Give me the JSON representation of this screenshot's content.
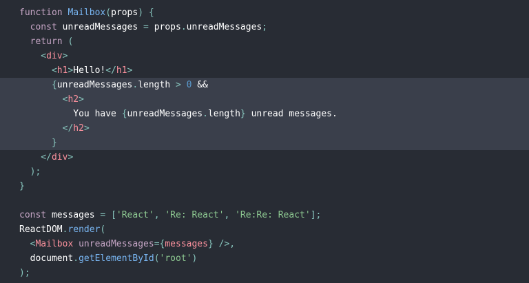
{
  "editor": {
    "colors": {
      "background": "#282c34",
      "highlight": "#3a3f4b",
      "keyword": "#c5a5c5",
      "function": "#79b6f2",
      "tag": "#fc929e",
      "string": "#8dc891",
      "number": "#5a9bcf",
      "punctuation": "#88c6be",
      "text": "#ffffff"
    },
    "lines": [
      {
        "highlighted": false,
        "tokens": [
          {
            "t": "function ",
            "c": "kw"
          },
          {
            "t": "Mailbox",
            "c": "fn"
          },
          {
            "t": "(",
            "c": "pun"
          },
          {
            "t": "props",
            "c": "txt"
          },
          {
            "t": ") {",
            "c": "pun"
          }
        ]
      },
      {
        "highlighted": false,
        "tokens": [
          {
            "t": "  const ",
            "c": "kw"
          },
          {
            "t": "unreadMessages ",
            "c": "txt"
          },
          {
            "t": "= ",
            "c": "pun"
          },
          {
            "t": "props",
            "c": "txt"
          },
          {
            "t": ".",
            "c": "pun"
          },
          {
            "t": "unreadMessages",
            "c": "txt"
          },
          {
            "t": ";",
            "c": "pun"
          }
        ]
      },
      {
        "highlighted": false,
        "tokens": [
          {
            "t": "  return ",
            "c": "kw"
          },
          {
            "t": "(",
            "c": "pun"
          }
        ]
      },
      {
        "highlighted": false,
        "tokens": [
          {
            "t": "    <",
            "c": "pun"
          },
          {
            "t": "div",
            "c": "tag"
          },
          {
            "t": ">",
            "c": "pun"
          }
        ]
      },
      {
        "highlighted": false,
        "tokens": [
          {
            "t": "      <",
            "c": "pun"
          },
          {
            "t": "h1",
            "c": "tag"
          },
          {
            "t": ">",
            "c": "pun"
          },
          {
            "t": "Hello!",
            "c": "txt"
          },
          {
            "t": "</",
            "c": "pun"
          },
          {
            "t": "h1",
            "c": "tag"
          },
          {
            "t": ">",
            "c": "pun"
          }
        ]
      },
      {
        "highlighted": true,
        "tokens": [
          {
            "t": "      {",
            "c": "pun"
          },
          {
            "t": "unreadMessages",
            "c": "txt"
          },
          {
            "t": ".",
            "c": "pun"
          },
          {
            "t": "length ",
            "c": "txt"
          },
          {
            "t": "> ",
            "c": "pun"
          },
          {
            "t": "0 ",
            "c": "num"
          },
          {
            "t": "&&",
            "c": "txt"
          }
        ]
      },
      {
        "highlighted": true,
        "tokens": [
          {
            "t": "        <",
            "c": "pun"
          },
          {
            "t": "h2",
            "c": "tag"
          },
          {
            "t": ">",
            "c": "pun"
          }
        ]
      },
      {
        "highlighted": true,
        "tokens": [
          {
            "t": "          You have ",
            "c": "txt"
          },
          {
            "t": "{",
            "c": "pun"
          },
          {
            "t": "unreadMessages",
            "c": "txt"
          },
          {
            "t": ".",
            "c": "pun"
          },
          {
            "t": "length",
            "c": "txt"
          },
          {
            "t": "}",
            "c": "pun"
          },
          {
            "t": " unread messages.",
            "c": "txt"
          }
        ]
      },
      {
        "highlighted": true,
        "tokens": [
          {
            "t": "        </",
            "c": "pun"
          },
          {
            "t": "h2",
            "c": "tag"
          },
          {
            "t": ">",
            "c": "pun"
          }
        ]
      },
      {
        "highlighted": true,
        "tokens": [
          {
            "t": "      }",
            "c": "pun"
          }
        ]
      },
      {
        "highlighted": false,
        "tokens": [
          {
            "t": "    </",
            "c": "pun"
          },
          {
            "t": "div",
            "c": "tag"
          },
          {
            "t": ">",
            "c": "pun"
          }
        ]
      },
      {
        "highlighted": false,
        "tokens": [
          {
            "t": "  );",
            "c": "pun"
          }
        ]
      },
      {
        "highlighted": false,
        "tokens": [
          {
            "t": "}",
            "c": "pun"
          }
        ]
      },
      {
        "highlighted": false,
        "tokens": [
          {
            "t": "",
            "c": "txt"
          }
        ]
      },
      {
        "highlighted": false,
        "tokens": [
          {
            "t": "const ",
            "c": "kw"
          },
          {
            "t": "messages ",
            "c": "txt"
          },
          {
            "t": "= [",
            "c": "pun"
          },
          {
            "t": "'React'",
            "c": "str"
          },
          {
            "t": ", ",
            "c": "pun"
          },
          {
            "t": "'Re: React'",
            "c": "str"
          },
          {
            "t": ", ",
            "c": "pun"
          },
          {
            "t": "'Re:Re: React'",
            "c": "str"
          },
          {
            "t": "];",
            "c": "pun"
          }
        ]
      },
      {
        "highlighted": false,
        "tokens": [
          {
            "t": "ReactDOM",
            "c": "txt"
          },
          {
            "t": ".",
            "c": "pun"
          },
          {
            "t": "render",
            "c": "fn"
          },
          {
            "t": "(",
            "c": "pun"
          }
        ]
      },
      {
        "highlighted": false,
        "tokens": [
          {
            "t": "  <",
            "c": "pun"
          },
          {
            "t": "Mailbox ",
            "c": "tag"
          },
          {
            "t": "unreadMessages",
            "c": "kw"
          },
          {
            "t": "={",
            "c": "pun"
          },
          {
            "t": "messages",
            "c": "tag"
          },
          {
            "t": "} />,",
            "c": "pun"
          }
        ]
      },
      {
        "highlighted": false,
        "tokens": [
          {
            "t": "  document",
            "c": "txt"
          },
          {
            "t": ".",
            "c": "pun"
          },
          {
            "t": "getElementById",
            "c": "fn"
          },
          {
            "t": "(",
            "c": "pun"
          },
          {
            "t": "'root'",
            "c": "str"
          },
          {
            "t": ")",
            "c": "pun"
          }
        ]
      },
      {
        "highlighted": false,
        "tokens": [
          {
            "t": ");",
            "c": "pun"
          }
        ]
      }
    ]
  }
}
